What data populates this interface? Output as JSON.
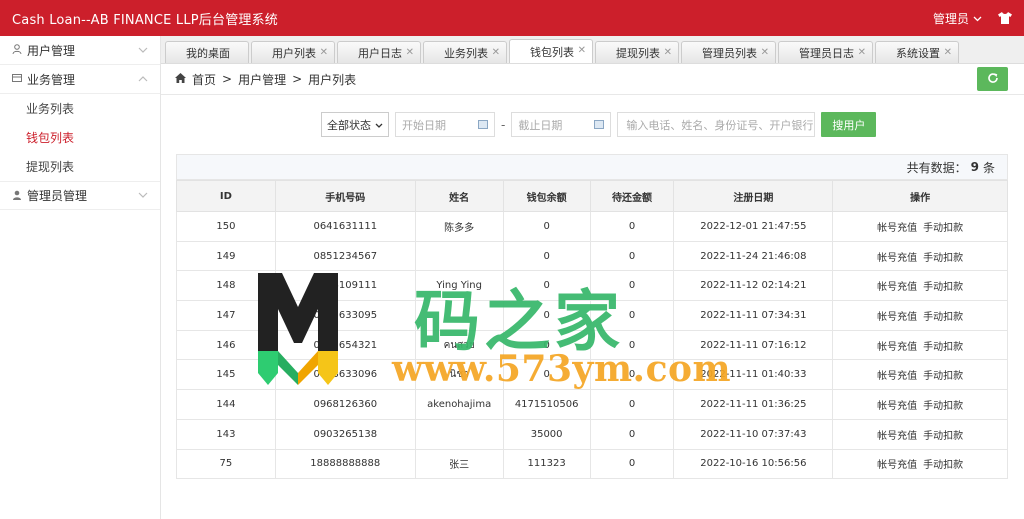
{
  "app": {
    "title": "Cash Loan--AB FINANCE LLP后台管理系统",
    "admin_label": "管理员",
    "colors": {
      "brand": "#cc1f2b",
      "success": "#5cb85c",
      "active_menu": "#cc1f2b"
    }
  },
  "sidebar": {
    "groups": [
      {
        "label": "用户管理",
        "icon": "user-icon",
        "expanded": false
      },
      {
        "label": "业务管理",
        "icon": "business-icon",
        "expanded": true,
        "items": [
          {
            "label": "业务列表"
          },
          {
            "label": "钱包列表",
            "active": true
          },
          {
            "label": "提现列表"
          }
        ]
      },
      {
        "label": "管理员管理",
        "icon": "admin-icon",
        "expanded": false
      }
    ]
  },
  "tabs": [
    {
      "label": "我的桌面",
      "closable": false
    },
    {
      "label": "用户列表",
      "closable": true
    },
    {
      "label": "用户日志",
      "closable": true
    },
    {
      "label": "业务列表",
      "closable": true
    },
    {
      "label": "钱包列表",
      "closable": true,
      "active": true
    },
    {
      "label": "提现列表",
      "closable": true
    },
    {
      "label": "管理员列表",
      "closable": true
    },
    {
      "label": "管理员日志",
      "closable": true
    },
    {
      "label": "系统设置",
      "closable": true
    }
  ],
  "breadcrumb": {
    "home": "首页",
    "level1": "用户管理",
    "level2": "用户列表",
    "separator": ">"
  },
  "filter": {
    "status_value": "全部状态",
    "start_placeholder": "开始日期",
    "end_placeholder": "截止日期",
    "separator": "-",
    "search_placeholder": "输入电话、姓名、身份证号、开户银行",
    "search_button": "搜用户"
  },
  "summary": {
    "prefix": "共有数据：",
    "count": "9",
    "suffix": "条"
  },
  "table": {
    "columns": [
      "ID",
      "手机号码",
      "姓名",
      "钱包余额",
      "待还金额",
      "注册日期",
      "操作"
    ],
    "action_labels": [
      "帐号充值",
      "手动扣款"
    ],
    "rows": [
      {
        "id": "150",
        "phone": "0641631111",
        "name": "陈多多",
        "balance": "0",
        "due": "0",
        "date": "2022-12-01 21:47:55"
      },
      {
        "id": "149",
        "phone": "0851234567",
        "name": "",
        "balance": "0",
        "due": "0",
        "date": "2022-11-24 21:46:08"
      },
      {
        "id": "148",
        "phone": "0848109111",
        "name": "Ying Ying",
        "balance": "0",
        "due": "0",
        "date": "2022-11-12 02:14:21"
      },
      {
        "id": "147",
        "phone": "0823633095",
        "name": "",
        "balance": "0",
        "due": "0",
        "date": "2022-11-11 07:34:31"
      },
      {
        "id": "146",
        "phone": "0987654321",
        "name": "คนสวย",
        "balance": "0",
        "due": "0",
        "date": "2022-11-11 07:16:12"
      },
      {
        "id": "145",
        "phone": "0823633096",
        "name": "นิชา",
        "balance": "0",
        "due": "0",
        "date": "2022-11-11 01:40:33"
      },
      {
        "id": "144",
        "phone": "0968126360",
        "name": "akenohajima",
        "balance": "4171510506",
        "due": "0",
        "date": "2022-11-11 01:36:25"
      },
      {
        "id": "143",
        "phone": "0903265138",
        "name": "",
        "balance": "35000",
        "due": "0",
        "date": "2022-11-10 07:37:43"
      },
      {
        "id": "75",
        "phone": "18888888888",
        "name": "张三",
        "balance": "111323",
        "due": "0",
        "date": "2022-10-16 10:56:56"
      }
    ]
  },
  "watermark": {
    "cn": "码之家",
    "url": "www.573ym.com"
  }
}
